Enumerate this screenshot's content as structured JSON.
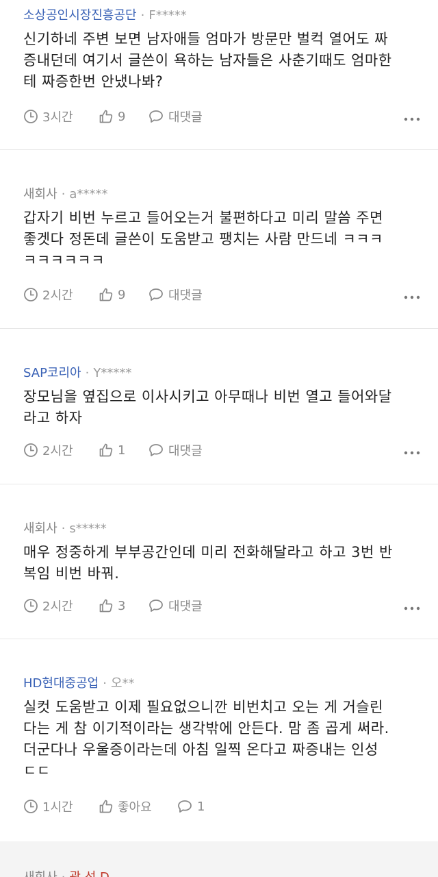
{
  "comments": [
    {
      "company": "소상공인시장진흥공단",
      "company_colored": true,
      "separator": "·",
      "user": "F*****",
      "lines": [
        "신기하네 주변 보면 남자애들 엄마가 방문만 벌컥 열어도 짜",
        "증내던데 여기서 글쓴이 욕하는 남자들은 사춘기때도 엄마한",
        "테 짜증한번 안냈나봐?"
      ],
      "time": "3시간",
      "likes": "9",
      "reply_label": "대댓글",
      "more_icon": "more-dots-icon"
    },
    {
      "company": "새회사",
      "company_colored": false,
      "separator": "·",
      "user": "a*****",
      "lines": [
        "갑자기 비번 누르고 들어오는거 불편하다고 미리 말씀 주면",
        "좋겟다 정돈데 글쓴이 도움받고 팽치는 사람 만드네 ㅋㅋㅋ",
        "ㅋㅋㅋㅋㅋㅋ"
      ],
      "time": "2시간",
      "likes": "9",
      "reply_label": "대댓글",
      "more_icon": "more-dots-icon"
    },
    {
      "company": "SAP코리아",
      "company_colored": true,
      "separator": "·",
      "user": "Y*****",
      "lines": [
        "장모님을 옆집으로 이사시키고 아무때나 비번 열고 들어와달",
        "라고 하자"
      ],
      "time": "2시간",
      "likes": "1",
      "reply_label": "대댓글",
      "more_icon": "more-dots-icon"
    },
    {
      "company": "새회사",
      "company_colored": false,
      "separator": "·",
      "user": "s*****",
      "lines": [
        "매우 정중하게 부부공간인데 미리 전화해달라고 하고 3번 반",
        "복임 비번 바꿔."
      ],
      "time": "2시간",
      "likes": "3",
      "reply_label": "대댓글",
      "more_icon": "more-dots-icon"
    },
    {
      "company": "HD현대중공업",
      "company_colored": true,
      "separator": "·",
      "user": "오**",
      "lines": [
        "실컷 도움받고 이제 필요없으니깐 비번치고 오는 게 거슬린",
        "다는 게 참 이기적이라는 생각밖에 안든다. 맘 좀 곱게 써라.",
        "더군다나 우울증이라는데 아침 일찍 온다고 짜증내는 인성",
        "ㄷㄷ"
      ],
      "time": "1시간",
      "likes": "좋아요",
      "reply_label": "1",
      "more_icon": ""
    }
  ],
  "peek": {
    "company": "새회사",
    "user": "광 선 D"
  },
  "icons": {
    "clock": "clock-icon",
    "like": "thumbs-up-icon",
    "reply": "speech-bubble-icon"
  },
  "colors": {
    "company_link": "#3a62b6",
    "muted": "#8a8a8a",
    "text": "#222222",
    "divider": "#e6e6e6",
    "bottom_bg": "#f4f4f4"
  }
}
